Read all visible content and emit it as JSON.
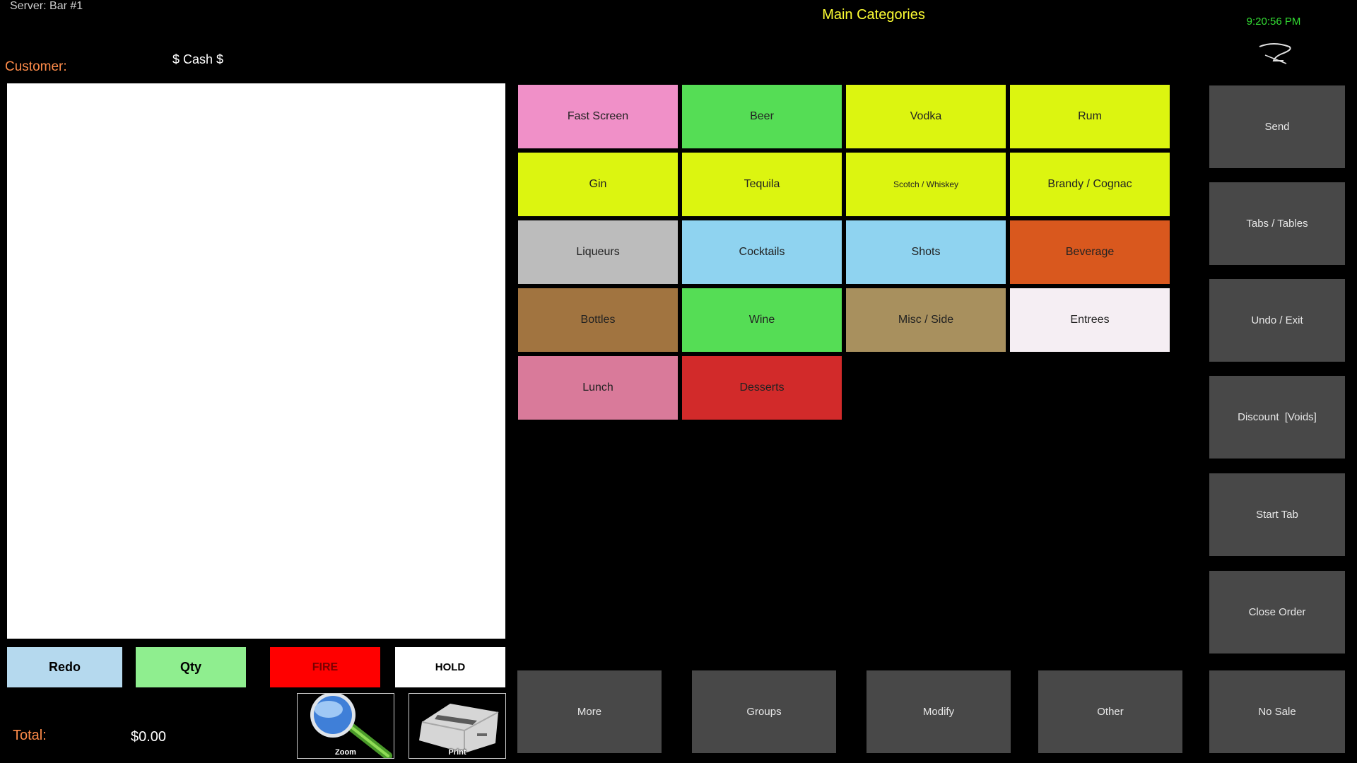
{
  "header": {
    "server": "Server: Bar #1",
    "title": "Main Categories",
    "clock": "9:20:56 PM",
    "customer_label": "Customer:",
    "payment_type": "$ Cash $"
  },
  "order_actions": {
    "redo": "Redo",
    "qty": "Qty",
    "fire": "FIRE",
    "hold": "HOLD",
    "zoom": "Zoom",
    "print": "Print"
  },
  "total": {
    "label": "Total:",
    "value": "$0.00"
  },
  "categories": [
    {
      "label": "Fast Screen",
      "color": "#f090c8"
    },
    {
      "label": "Beer",
      "color": "#55dd55"
    },
    {
      "label": "Vodka",
      "color": "#dcf510"
    },
    {
      "label": "Rum",
      "color": "#dcf510"
    },
    {
      "label": "Gin",
      "color": "#dcf510"
    },
    {
      "label": "Tequila",
      "color": "#dcf510"
    },
    {
      "label": "Scotch / Whiskey",
      "color": "#dcf510"
    },
    {
      "label": "Brandy / Cognac",
      "color": "#dcf510"
    },
    {
      "label": "Liqueurs",
      "color": "#bcbcbc"
    },
    {
      "label": "Cocktails",
      "color": "#8fd3f0"
    },
    {
      "label": "Shots",
      "color": "#8fd3f0"
    },
    {
      "label": "Beverage",
      "color": "#d9581e"
    },
    {
      "label": "Bottles",
      "color": "#a17440"
    },
    {
      "label": "Wine",
      "color": "#55dd55"
    },
    {
      "label": "Misc / Side",
      "color": "#a8905e"
    },
    {
      "label": "Entrees",
      "color": "#f5eef3"
    },
    {
      "label": "Lunch",
      "color": "#d97a9a"
    },
    {
      "label": "Desserts",
      "color": "#d22a2a"
    }
  ],
  "side_controls": [
    "Send",
    "Tabs / Tables",
    "Undo / Exit",
    "Discount  [Voids]",
    "Start Tab",
    "Close Order"
  ],
  "bottom_controls": [
    "More",
    "Groups",
    "Modify",
    "Other",
    "No Sale"
  ],
  "colors": {
    "title": "#ffff33",
    "clock": "#33dd33",
    "labels": "#ff8c4a",
    "control_button": "#484848"
  }
}
